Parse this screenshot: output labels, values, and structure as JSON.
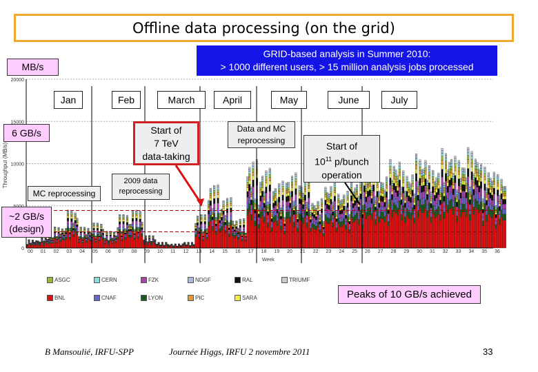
{
  "title": "Offline data processing (on the grid)",
  "banner": {
    "line1": "GRID-based analysis in Summer 2010:",
    "line2": "> 1000 different users, > 15 million analysis jobs processed"
  },
  "unit_label": "MB/s",
  "months": [
    "Jan",
    "Feb",
    "March",
    "April",
    "May",
    "June",
    "July"
  ],
  "annotations": {
    "six": "6 GB/s",
    "two_l1": "~2 GB/s",
    "two_l2": "(design)",
    "tev_l1": "Start of",
    "tev_l2": "7 TeV",
    "tev_l3": "data-taking",
    "dmc_l1": "Data and MC",
    "dmc_l2": "reprocessing",
    "p_l1": "Start of",
    "p_l2a": "10",
    "p_sup": "11",
    "p_l2b": " p/bunch",
    "p_l3": "operation",
    "mc": "MC reprocessing",
    "r09_l1": "2009 data",
    "r09_l2": "reprocessing",
    "peaks": "Peaks of 10 GB/s achieved"
  },
  "footer": {
    "author": "B Mansoulié, IRFU-SPP",
    "event": "Journée Higgs, IRFU 2 novembre 2011",
    "page": "33"
  },
  "chart_data": {
    "type": "bar",
    "stacked": true,
    "xlabel": "Week",
    "ylabel": "Throughput (MB/s)",
    "ylim": [
      0,
      20000
    ],
    "yticks": [
      0,
      5000,
      10000,
      15000,
      20000
    ],
    "categories": [
      "00",
      "01",
      "02",
      "03",
      "04",
      "05",
      "06",
      "07",
      "08",
      "09",
      "10",
      "11",
      "12",
      "13",
      "14",
      "15",
      "16",
      "17",
      "18",
      "19",
      "20",
      "21",
      "22",
      "23",
      "24",
      "25",
      "26",
      "27",
      "28",
      "29",
      "30",
      "31",
      "32",
      "33",
      "34",
      "35",
      "36"
    ],
    "totals": [
      1000,
      1500,
      2500,
      4500,
      2500,
      3000,
      2000,
      4000,
      4500,
      1500,
      700,
      500,
      700,
      4000,
      7500,
      6000,
      3500,
      10500,
      9500,
      8000,
      9000,
      8500,
      6000,
      8000,
      7000,
      8500,
      10000,
      9000,
      11000,
      9500,
      11500,
      10000,
      12000,
      11000,
      12000,
      10000,
      9000
    ],
    "reference_lines": [
      {
        "label": "6 GB/s",
        "value": 6000
      },
      {
        "label": "~2 GB/s (design)",
        "value": 2000
      }
    ],
    "legend": [
      {
        "name": "ASGC",
        "color": "#99bb33"
      },
      {
        "name": "CERN",
        "color": "#88dddd"
      },
      {
        "name": "FZK",
        "color": "#aa44aa"
      },
      {
        "name": "NDGF",
        "color": "#aabbdd"
      },
      {
        "name": "RAL",
        "color": "#111111"
      },
      {
        "name": "TRIUMF",
        "color": "#cccccc"
      },
      {
        "name": "BNL",
        "color": "#e01010"
      },
      {
        "name": "CNAF",
        "color": "#6666cc"
      },
      {
        "name": "LYON",
        "color": "#1d5a1d"
      },
      {
        "name": "PIC",
        "color": "#e09933"
      },
      {
        "name": "SARA",
        "color": "#eeee44"
      }
    ]
  },
  "colors": {
    "title_border": "#f0a830",
    "banner": "#1414e6",
    "pink": "#ffccff",
    "dash": "#990000",
    "arrow_red": "#dd1111"
  }
}
